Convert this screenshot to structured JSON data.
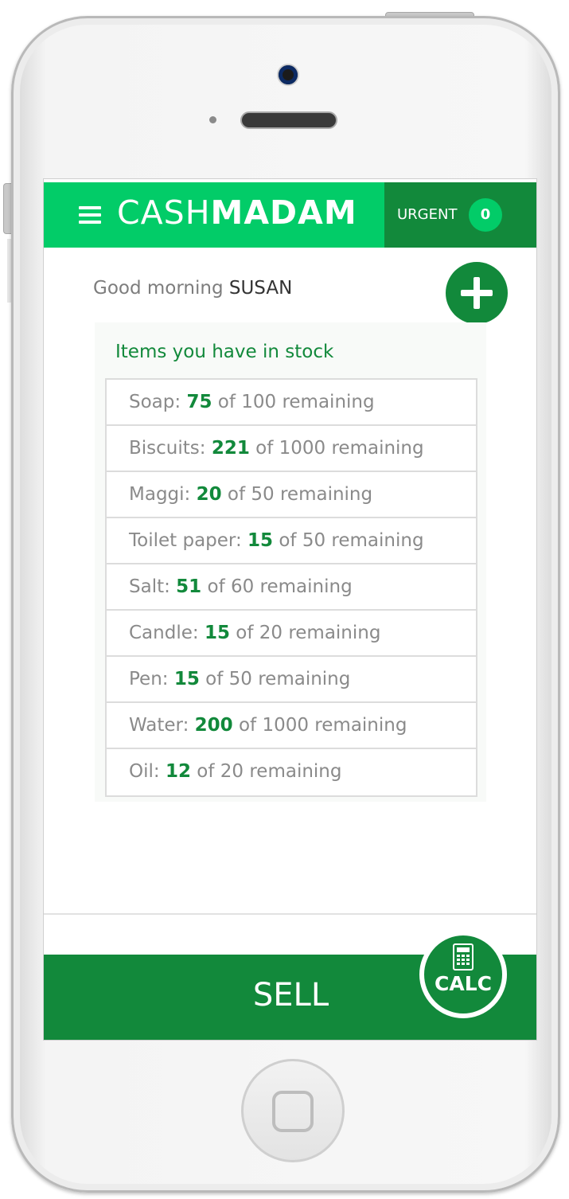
{
  "app": {
    "brand_light": "CASH",
    "brand_bold": "MADAM"
  },
  "urgent": {
    "label": "URGENT",
    "count": "0"
  },
  "greeting": {
    "text": "Good morning",
    "name": "SUSAN"
  },
  "stock": {
    "heading": "Items you have in stock",
    "items": [
      {
        "name": "Soap: ",
        "qty": "75",
        "suffix": " of 100 remaining"
      },
      {
        "name": "Biscuits: ",
        "qty": "221",
        "suffix": " of 1000 remaining"
      },
      {
        "name": "Maggi: ",
        "qty": "20",
        "suffix": " of 50 remaining"
      },
      {
        "name": "Toilet paper: ",
        "qty": "15",
        "suffix": " of 50 remaining"
      },
      {
        "name": "Salt: ",
        "qty": "51",
        "suffix": " of 60 remaining"
      },
      {
        "name": "Candle: ",
        "qty": "15",
        "suffix": " of 20 remaining"
      },
      {
        "name": "Pen: ",
        "qty": "15",
        "suffix": " of 50 remaining"
      },
      {
        "name": "Water: ",
        "qty": "200",
        "suffix": " of 1000 remaining"
      },
      {
        "name": "Oil: ",
        "qty": "12",
        "suffix": " of 20 remaining"
      }
    ]
  },
  "actions": {
    "sell_label": "SELL",
    "calc_label": "CALC"
  },
  "icons": {
    "menu": "menu-icon",
    "add": "plus-icon",
    "calculator": "calculator-icon",
    "home": "home-button-icon"
  },
  "colors": {
    "brand_green": "#02cc68",
    "dark_green": "#12893b"
  }
}
